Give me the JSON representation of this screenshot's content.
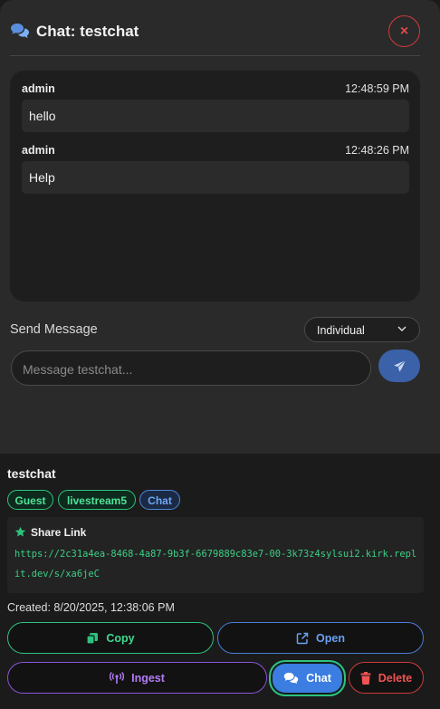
{
  "modal": {
    "title": "Chat: testchat",
    "close_label": "×"
  },
  "messages": [
    {
      "user": "admin",
      "time": "12:48:59 PM",
      "text": "hello"
    },
    {
      "user": "admin",
      "time": "12:48:26 PM",
      "text": "Help"
    }
  ],
  "composer": {
    "label": "Send Message",
    "mode_selected": "Individual",
    "placeholder": "Message testchat..."
  },
  "item": {
    "name": "testchat",
    "tags": [
      "Guest",
      "livestream5",
      "Chat"
    ],
    "share_title": "Share Link",
    "share_url": "https://2c31a4ea-8468-4a87-9b3f-6679889c83e7-00-3k73z4sylsui2.kirk.replit.dev/s/xa6jeC",
    "created": "Created: 8/20/2025, 12:38:06 PM"
  },
  "actions": {
    "copy": "Copy",
    "open": "Open",
    "ingest": "Ingest",
    "chat": "Chat",
    "delete": "Delete"
  },
  "colors": {
    "accent_green": "#2ec27e",
    "accent_blue": "#3b7de0",
    "accent_purple": "#8a54d8",
    "danger_red": "#cf3a3a"
  },
  "icons": [
    "chat-bubbles-icon",
    "close-icon",
    "chevron-down-icon",
    "send-icon",
    "star-icon",
    "copy-icon",
    "external-link-icon",
    "broadcast-icon",
    "trash-icon"
  ]
}
